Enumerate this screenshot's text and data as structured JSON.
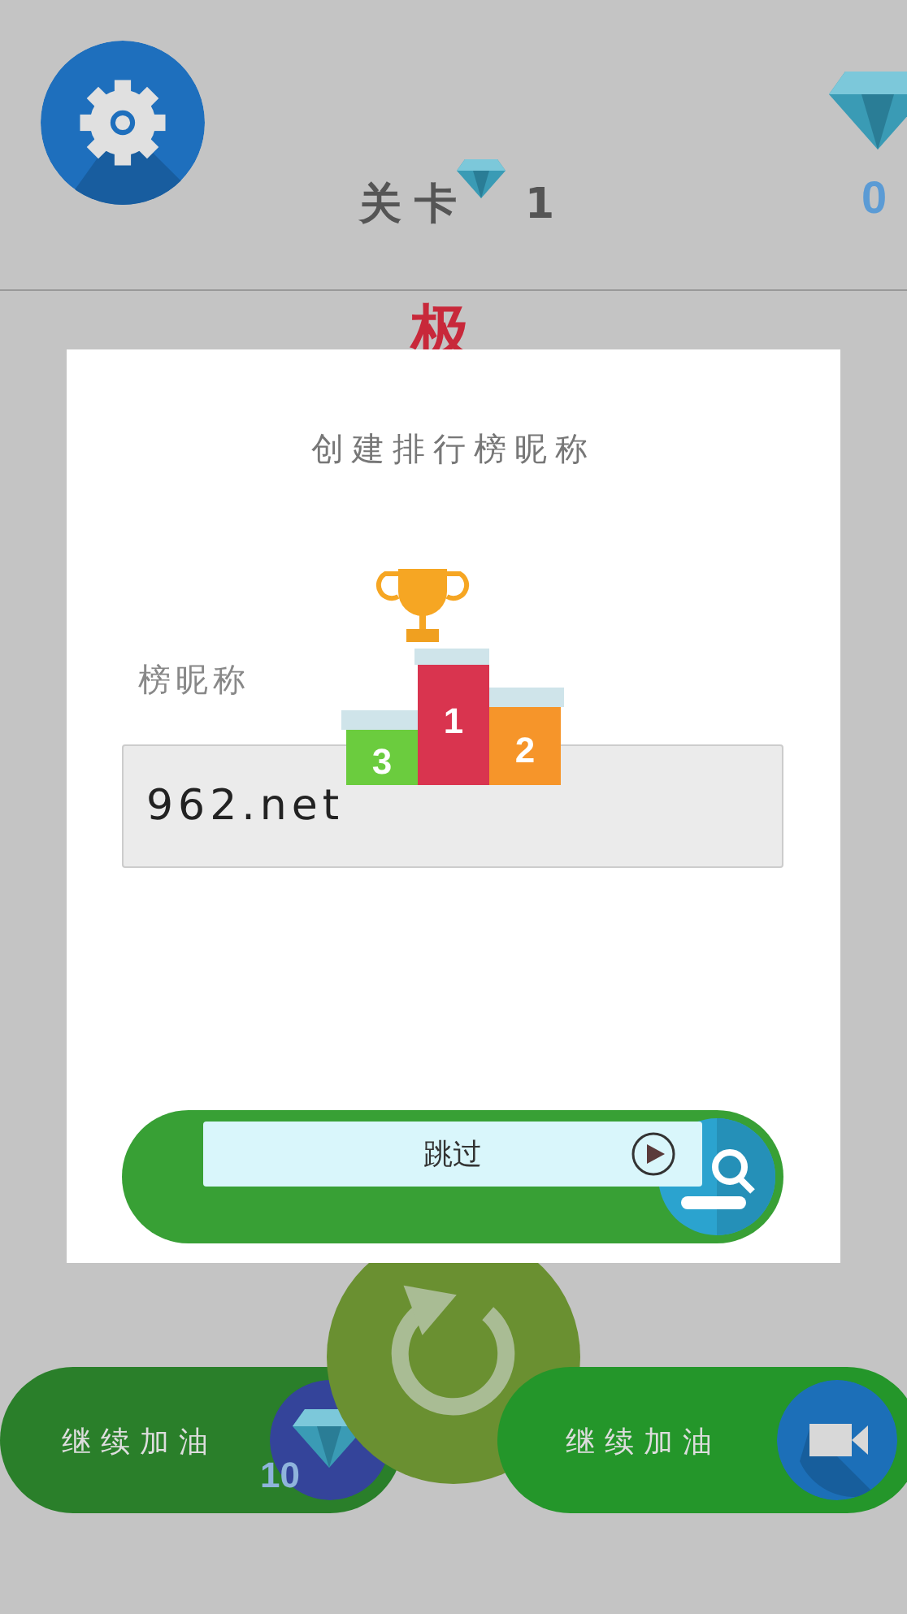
{
  "hud": {
    "level_label": "关卡",
    "level": "1",
    "gems": "0"
  },
  "banner_char": "极",
  "dialog": {
    "title": "创建排行榜昵称",
    "podium": [
      "3",
      "1",
      "2"
    ],
    "field_label": "榜昵称",
    "nickname": {
      "value": "962.net"
    },
    "skip_bar": {
      "label": "跳过"
    }
  },
  "bottom_buttons": [
    {
      "kind": "gem",
      "label": "继续加油",
      "cost": "10"
    },
    {
      "kind": "video",
      "label": "继续加油"
    }
  ]
}
